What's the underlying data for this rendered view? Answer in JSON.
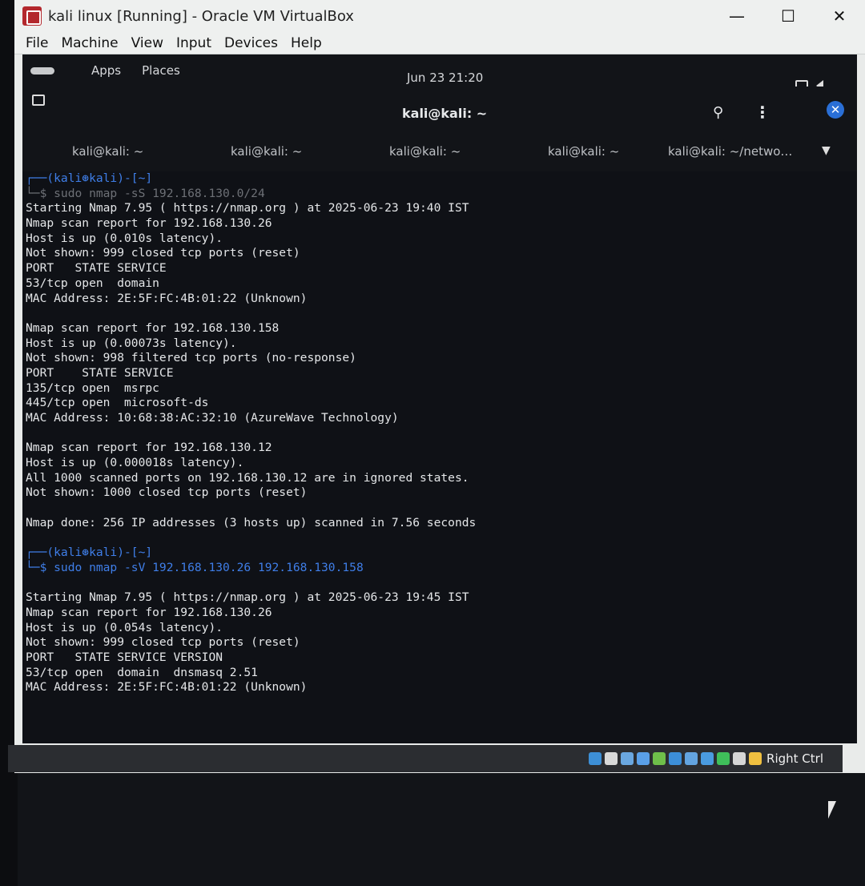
{
  "window": {
    "title": "kali linux [Running] - Oracle VM VirtualBox",
    "minimize": "—",
    "maximize": "☐",
    "close": "✕"
  },
  "menu": [
    "File",
    "Machine",
    "View",
    "Input",
    "Devices",
    "Help"
  ],
  "gnome": {
    "apps": "Apps",
    "places": "Places",
    "clock": "Jun 23  21:20"
  },
  "terminal_header": {
    "title": "kali@kali: ~",
    "search": "⚲",
    "menu": "⋮",
    "close": "✕"
  },
  "tabs": [
    "kali@kali: ~",
    "kali@kali: ~",
    "kali@kali: ~",
    "kali@kali: ~",
    "kali@kali: ~/netwo…"
  ],
  "terminal_lines": [
    "┌──(kali⊛kali)-[~]",
    "└─$ sudo nmap -sS 192.168.130.0/24",
    "Starting Nmap 7.95 ( https://nmap.org ) at 2025-06-23 19:40 IST",
    "Nmap scan report for 192.168.130.26",
    "Host is up (0.010s latency).",
    "Not shown: 999 closed tcp ports (reset)",
    "PORT   STATE SERVICE",
    "53/tcp open  domain",
    "MAC Address: 2E:5F:FC:4B:01:22 (Unknown)",
    "",
    "Nmap scan report for 192.168.130.158",
    "Host is up (0.00073s latency).",
    "Not shown: 998 filtered tcp ports (no-response)",
    "PORT    STATE SERVICE",
    "135/tcp open  msrpc",
    "445/tcp open  microsoft-ds",
    "MAC Address: 10:68:38:AC:32:10 (AzureWave Technology)",
    "",
    "Nmap scan report for 192.168.130.12",
    "Host is up (0.000018s latency).",
    "All 1000 scanned ports on 192.168.130.12 are in ignored states.",
    "Not shown: 1000 closed tcp ports (reset)",
    "",
    "Nmap done: 256 IP addresses (3 hosts up) scanned in 7.56 seconds",
    "",
    "┌──(kali⊛kali)-[~]",
    "└─$ sudo nmap -sV 192.168.130.26 192.168.130.158",
    "",
    "Starting Nmap 7.95 ( https://nmap.org ) at 2025-06-23 19:45 IST",
    "Nmap scan report for 192.168.130.26",
    "Host is up (0.054s latency).",
    "Not shown: 999 closed tcp ports (reset)",
    "PORT   STATE SERVICE VERSION",
    "53/tcp open  domain  dnsmasq 2.51",
    "MAC Address: 2E:5F:FC:4B:01:22 (Unknown)"
  ],
  "statusbar": {
    "host_key": "Right Ctrl",
    "icon_names": [
      "hard-disk-icon",
      "optical-drive-icon",
      "audio-icon",
      "network-icon",
      "usb-icon",
      "shared-folder-icon",
      "display-icon",
      "recording-icon",
      "cpu-icon",
      "mouse-integration-icon",
      "keyboard-icon"
    ],
    "icon_colors": [
      "#3d8fd6",
      "#d9d9d9",
      "#6aa7e0",
      "#5aa0e8",
      "#6fbf4a",
      "#3c8ed8",
      "#63a4e0",
      "#4a9be0",
      "#3fbf5a",
      "#d6d6d6",
      "#f0c040"
    ]
  }
}
